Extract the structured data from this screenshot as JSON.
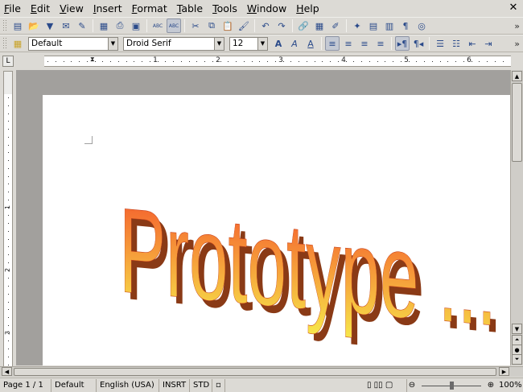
{
  "menu": [
    "File",
    "Edit",
    "View",
    "Insert",
    "Format",
    "Table",
    "Tools",
    "Window",
    "Help"
  ],
  "close_doc_glyph": "✕",
  "toolbar1": {
    "buttons": [
      {
        "name": "new-document-icon",
        "glyph": "▤"
      },
      {
        "name": "open-icon",
        "glyph": "📂"
      },
      {
        "name": "save-icon",
        "glyph": "▼"
      },
      {
        "name": "email-icon",
        "glyph": "✉"
      },
      {
        "name": "edit-file-icon",
        "glyph": "✎"
      },
      {
        "name": "export-pdf-icon",
        "glyph": "▦"
      },
      {
        "name": "print-icon",
        "glyph": "⎙"
      },
      {
        "name": "page-preview-icon",
        "glyph": "▣"
      },
      {
        "name": "spellcheck-icon",
        "glyph": "ABC"
      },
      {
        "name": "autospellcheck-icon",
        "glyph": "ABC"
      },
      {
        "name": "cut-icon",
        "glyph": "✂"
      },
      {
        "name": "copy-icon",
        "glyph": "⧉"
      },
      {
        "name": "paste-icon",
        "glyph": "📋"
      },
      {
        "name": "format-paintbrush-icon",
        "glyph": "🖌"
      },
      {
        "name": "undo-icon",
        "glyph": "↶"
      },
      {
        "name": "redo-icon",
        "glyph": "↷"
      },
      {
        "name": "hyperlink-icon",
        "glyph": "🔗"
      },
      {
        "name": "table-icon",
        "glyph": "▦"
      },
      {
        "name": "show-draw-functions-icon",
        "glyph": "✐"
      },
      {
        "name": "navigator-icon",
        "glyph": "✦"
      },
      {
        "name": "gallery-icon",
        "glyph": "▤"
      },
      {
        "name": "data-sources-icon",
        "glyph": "▥"
      },
      {
        "name": "formatting-marks-icon",
        "glyph": "¶"
      },
      {
        "name": "help-icon",
        "glyph": "◎"
      }
    ]
  },
  "toolbar2": {
    "style": "Default",
    "font_name": "Droid Serif",
    "font_size": "12",
    "dropdown_glyph": "▼",
    "buttons": [
      {
        "name": "bold-icon",
        "glyph": "A"
      },
      {
        "name": "italic-icon",
        "glyph": "A"
      },
      {
        "name": "underline-icon",
        "glyph": "A"
      },
      {
        "name": "align-left-icon",
        "glyph": "≡"
      },
      {
        "name": "align-center-icon",
        "glyph": "≡"
      },
      {
        "name": "align-right-icon",
        "glyph": "≡"
      },
      {
        "name": "justify-icon",
        "glyph": "≡"
      },
      {
        "name": "left-to-right-icon",
        "glyph": "▸¶"
      },
      {
        "name": "right-to-left-icon",
        "glyph": "¶◂"
      },
      {
        "name": "numbering-icon",
        "glyph": "☰"
      },
      {
        "name": "bullets-icon",
        "glyph": "☷"
      },
      {
        "name": "decrease-indent-icon",
        "glyph": "⇤"
      },
      {
        "name": "increase-indent-icon",
        "glyph": "⇥"
      }
    ],
    "more_glyph": "»"
  },
  "ruler": {
    "labels": [
      "1",
      "2",
      "3",
      "4",
      "5",
      "6"
    ],
    "vertical_labels": [
      "1",
      "2",
      "3"
    ]
  },
  "document": {
    "fontwork_text": "Prototype ..."
  },
  "status": {
    "page": "Page 1 / 1",
    "style": "Default",
    "language": "English (USA)",
    "insert_mode": "INSRT",
    "selection_mode": "STD",
    "zoom_percent": 100,
    "zoom": "100%"
  },
  "colors": {
    "ui_gray": "#dcdad5",
    "doc_background": "#a2a09d",
    "fontwork_top": "#f4502a",
    "fontwork_bottom": "#f7e84a",
    "fontwork_extrusion": "#8a3a16"
  }
}
